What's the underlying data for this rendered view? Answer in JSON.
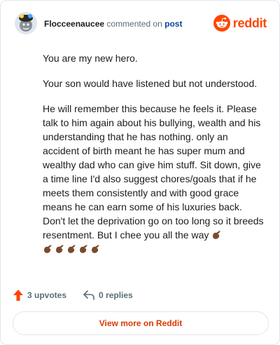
{
  "header": {
    "username": "Flocceenaucee",
    "action_text": "commented on",
    "post_link": "post",
    "brand": "reddit"
  },
  "comment": {
    "paragraphs": [
      "You are my new hero.",
      "Your son would have listened but not understood.",
      "He will remember this because he feels it. Please talk to him again about his bullying, wealth and his understanding that he has nothing. only an accident of birth meant he has super mum and wealthy dad who can give him stuff. Sit down, give a time line I'd also suggest chores/goals that if he meets them consistently and with good grace means he can earn some of his luxuries back. Don't let the deprivation go on too long so it breeds resentment. But I chee you all the way"
    ],
    "emoji_icon": "clapping-hands-icon"
  },
  "actions": {
    "upvotes": "3 upvotes",
    "replies": "0 replies"
  },
  "footer": {
    "view_more": "View more on Reddit"
  },
  "colors": {
    "brand": "#ff4500",
    "upvote": "#ff4500",
    "link": "#0a449b",
    "view_more_text": "#d93900"
  }
}
